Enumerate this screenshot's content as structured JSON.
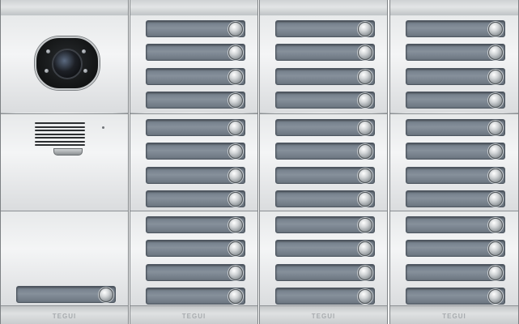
{
  "brand": {
    "logo_text": "TEGUI"
  },
  "colors": {
    "panel_silver": "#e6e8e9",
    "nameplate_blue_grey": "#7a848f",
    "button_chrome": "#d3d6d8",
    "camera_black": "#161819"
  },
  "panels": [
    {
      "type": "audio-video",
      "modules": [
        "camera-module",
        "speaker-module",
        "single-button-module"
      ],
      "buttons": 1
    },
    {
      "type": "push-buttons",
      "modules": 3,
      "buttons_per_module": 4
    },
    {
      "type": "push-buttons",
      "modules": 3,
      "buttons_per_module": 4
    },
    {
      "type": "push-buttons",
      "modules": 3,
      "buttons_per_module": 4
    }
  ],
  "icons": [
    "camera-icon",
    "speaker-grille-icon",
    "microphone-icon",
    "call-button-icon"
  ]
}
